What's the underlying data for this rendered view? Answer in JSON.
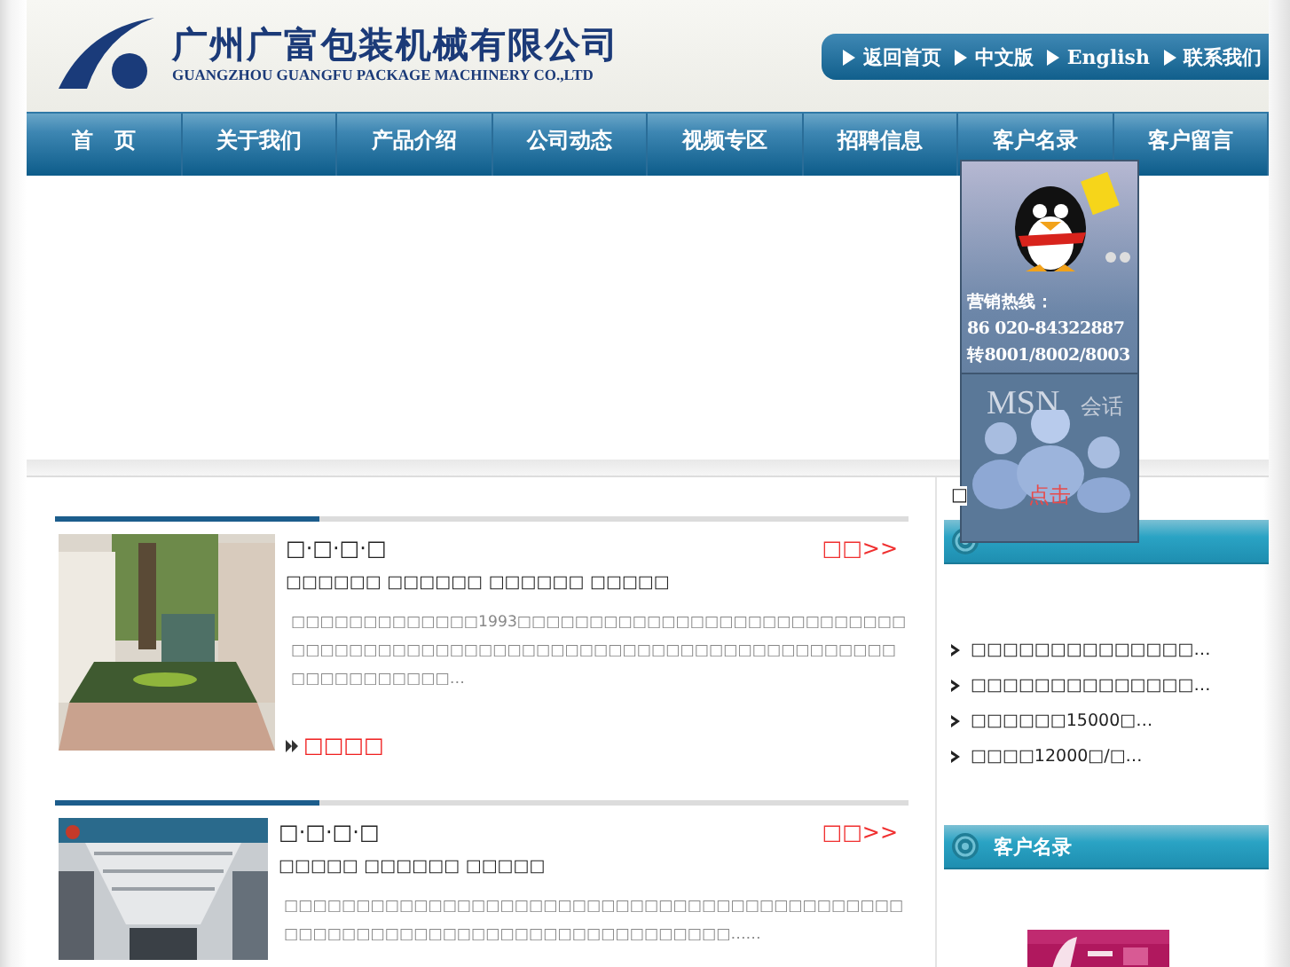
{
  "header": {
    "company_name": "广州广富包装机械有限公司",
    "company_name_en": "GUANGZHOU GUANGFU PACKAGE MACHINERY CO.,LTD",
    "quick_links": [
      "返回首页",
      "中文版",
      "English",
      "联系我们"
    ]
  },
  "nav": [
    {
      "label": "首　页",
      "selected": false
    },
    {
      "label": "关于我们",
      "selected": false
    },
    {
      "label": "产品介绍",
      "selected": false
    },
    {
      "label": "公司动态",
      "selected": false
    },
    {
      "label": "视频专区",
      "selected": false
    },
    {
      "label": "招聘信息",
      "selected": false
    },
    {
      "label": "客户名录",
      "selected": false
    },
    {
      "label": "客户留言",
      "selected": false
    }
  ],
  "float_panel": {
    "hotline_label": "营销热线：",
    "phone": "86 020-84322887",
    "extension": "转8001/8002/8003",
    "msn": "MSN",
    "chat": "会话",
    "click": "点击",
    "marker": "□"
  },
  "sections": [
    {
      "title": "□·□·□·□",
      "more": "□□>>",
      "headline": "□□□□□□ □□□□□□ □□□□□□ □□□□□",
      "body": "□□□□□□□□□□□□□1993□□□□□□□□□□□□□□□□□□□□□□□□□□□□□□□□□□□□□□□□□□□□□□□□□□□□□□□□□□□□□□□□□□□□□□□□□□□□□□□□…",
      "detail": "□□□□"
    },
    {
      "title": "□·□·□·□",
      "more": "□□>>",
      "headline": "□□□□□ □□□□□□ □□□□□",
      "body": "□□□□□□□□□□□□□□□□□□□□□□□□□□□□□□□□□□□□□□□□□□□□□□□□□□□□□□□□□□□□□□□□□□□□□□□□□□……"
    }
  ],
  "sidebar": {
    "news": [
      "□□□□□□□□□□□□□□…",
      "□□□□□□□□□□□□□□…",
      "□□□□□□15000□…",
      "□□□□12000□/□…"
    ],
    "clients_title": "客户名录"
  }
}
